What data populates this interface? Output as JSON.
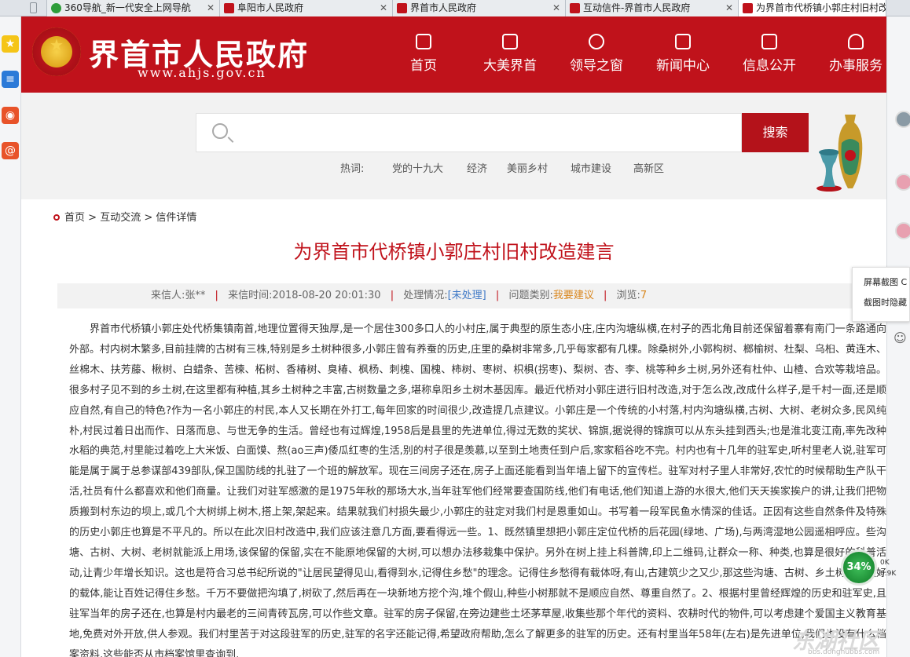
{
  "browser": {
    "tabs": [
      {
        "title": "360导航_新一代安全上网导航"
      },
      {
        "title": "阜阳市人民政府"
      },
      {
        "title": "界首市人民政府"
      },
      {
        "title": "互动信件-界首市人民政府"
      },
      {
        "title": "为界首市代桥镇小郭庄村旧村改"
      }
    ],
    "side_menu": {
      "screenshot": "屏幕截图 C",
      "hide": "截图时隐藏"
    }
  },
  "header": {
    "site_title": "界首市人民政府",
    "site_url": "www.ahjs.gov.cn",
    "nav": [
      {
        "label": "首页"
      },
      {
        "label": "大美界首"
      },
      {
        "label": "领导之窗"
      },
      {
        "label": "新闻中心"
      },
      {
        "label": "信息公开"
      },
      {
        "label": "办事服务"
      }
    ]
  },
  "search": {
    "placeholder": "",
    "button": "搜索",
    "hot_label": "热词:",
    "hot_words": [
      "党的十九大",
      "经济",
      "美丽乡村",
      "城市建设",
      "高新区"
    ]
  },
  "breadcrumb": {
    "home": "首页",
    "sep": ">",
    "section": "互动交流",
    "page": "信件详情"
  },
  "letter": {
    "title": "为界首市代桥镇小郭庄村旧村改造建言",
    "meta": {
      "sender_label": "来信人:",
      "sender": "张**",
      "time_label": "来信时间:",
      "time": "2018-08-20 20:01:30",
      "status_label": "处理情况:",
      "status": "[未处理]",
      "category_label": "问题类别:",
      "category": "我要建议",
      "views_label": "浏览:",
      "views": "7"
    },
    "body": "界首市代桥镇小郭庄处代桥集镇南首,地理位置得天独厚,是一个居住300多口人的小村庄,属于典型的原生态小庄,庄内沟塘纵横,在村子的西北角目前还保留着寨有南门一条路通向外部。村内树木繁多,目前挂牌的古树有三株,特别是乡土树种很多,小郭庄曾有养蚕的历史,庄里的桑树非常多,几乎每家都有几棵。除桑树外,小郭构树、榔榆树、杜梨、乌桕、黄连木、丝棉木、扶芳藤、楸树、白蜡条、苦楝、柘树、香椿树、臭椿、枫杨、刺槐、国槐、柿树、枣树、枳椇(拐枣)、梨树、杏、李、桃等种乡土树,另外还有杜仲、山楂、合欢等栽培品。很多村子见不到的乡土树,在这里都有种植,其乡土树种之丰富,古树数量之多,堪称阜阳乡土树木基因库。最近代桥对小郭庄进行旧村改造,对于怎么改,改成什么样子,是千村一面,还是顺应自然,有自己的特色?作为一名小郭庄的村民,本人又长期在外打工,每年回家的时间很少,改造提几点建议。小郭庄是一个传统的小村落,村内沟塘纵横,古树、大树、老树众多,民风纯朴,村民过着日出而作、日落而息、与世无争的生活。曾经也有过辉煌,1958后是县里的先进单位,得过无数的奖状、锦旗,据说得的锦旗可以从东头挂到西头;也是淮北变江南,率先改种水稻的典范,村里能过着吃上大米饭、白面馍、熬(ao三声)倭瓜红枣的生活,别的村子很是羡慕,以至到土地责任到户后,家家稻谷吃不完。村内也有十几年的驻军史,听村里老人说,驻军可能是属于属于总参谋部439部队,保卫国防线的扎驻了一个班的解放军。现在三间房子还在,房子上面还能看到当年墙上留下的宣传栏。驻军对村子里人非常好,农忙的时候帮助生产队干活,社员有什么都喜欢和他们商量。让我们对驻军感激的是1975年秋的那场大水,当年驻军他们经常要查国防线,他们有电话,他们知道上游的水很大,他们天天挨家挨户的讲,让我们把物质搬到村东边的坝上,或几个大树绑上树木,搭上架,架起来。结果就我们村损失最少,小郭庄的驻定对我们村是恩重如山。书写着一段军民鱼水情深的佳话。正因有这些自然条件及特殊的历史小郭庄也算是不平凡的。所以在此次旧村改造中,我们应该注意几方面,要看得远一些。1、既然镇里想把小郭庄定位代桥的后花园(绿地、广场),与两湾湿地公园遥相呼应。些沟塘、古树、大树、老树就能派上用场,该保留的保留,实在不能原地保留的大树,可以想办法移栽集中保护。另外在树上挂上科普牌,印上二维码,让群众一称、种类,也算是很好的科普活动,让青少年增长知识。这也是符合习总书纪所说的\"让居民望得见山,看得到水,记得住乡愁\"的理念。记得住乡愁得有载体呀,有山,古建筑少之又少,那这些沟塘、古树、乡土树就是很好的载体,能让百姓记得住乡愁。千万不要做把沟填了,树砍了,然后再在一块新地方挖个沟,堆个假山,种些小树那就不是顺应自然、尊重自然了。2、根据村里曾经辉煌的历史和驻军史,且驻军当年的房子还在,也算是村内最老的三间青砖瓦房,可以作些文章。驻军的房子保留,在旁边建些土坯茅草屋,收集些那个年代的资料、农耕时代的物件,可以考虑建个爱国主义教育基地,免费对外开放,供人参观。我们村里苦于对这段驻军的历史,驻军的名字还能记得,希望政府帮助,怎么了解更多的驻军的历史。还有村里当年58年(左右)是先进单位,我们也没有什么档案资料,这些能否从市档案馆里查询到,"
  },
  "status": {
    "net_percent": "34%",
    "up": "0K",
    "down": "0.9K"
  },
  "watermark": {
    "text": "东湖社区",
    "url": "bbs.donghubbs.com"
  }
}
